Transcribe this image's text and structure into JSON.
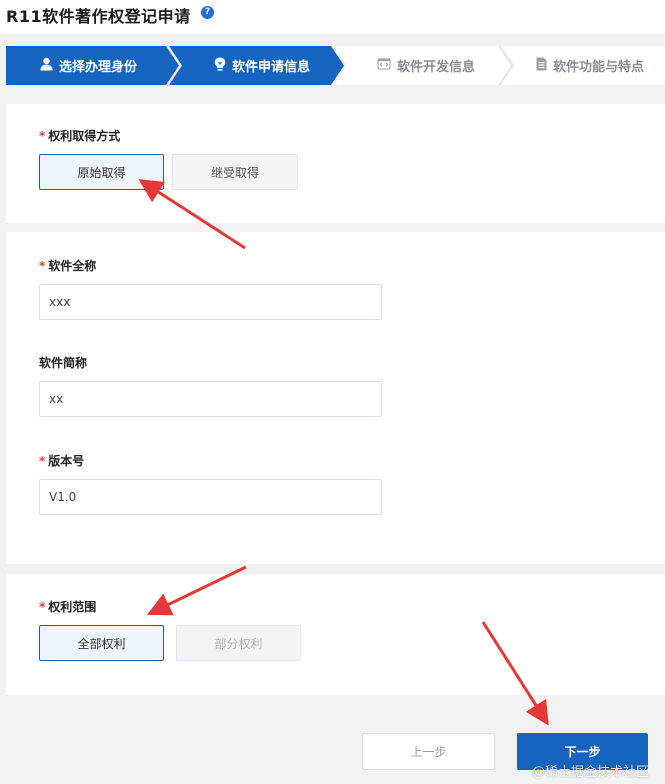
{
  "header": {
    "title": "R11软件著作权登记申请",
    "help_icon": "question-circle-icon"
  },
  "steps": [
    {
      "label": "选择办理身份",
      "icon": "user-icon",
      "state": "completed"
    },
    {
      "label": "软件申请信息",
      "icon": "lightbulb-icon",
      "state": "active"
    },
    {
      "label": "软件开发信息",
      "icon": "code-window-icon",
      "state": "inactive"
    },
    {
      "label": "软件功能与特点",
      "icon": "document-icon",
      "state": "inactive"
    }
  ],
  "acquisition": {
    "label": "权利取得方式",
    "options": [
      "原始取得",
      "继受取得"
    ],
    "selected": "原始取得"
  },
  "software": {
    "full_name_label": "软件全称",
    "full_name_value": "xxx",
    "short_name_label": "软件简称",
    "short_name_value": "xx",
    "version_label": "版本号",
    "version_value": "V1.0"
  },
  "rights_scope": {
    "label": "权利范围",
    "options": [
      "全部权利",
      "部分权利"
    ],
    "selected": "全部权利"
  },
  "footer": {
    "prev_label": "上一步",
    "next_label": "下一步"
  },
  "watermark": "@稀土掘金技术社区",
  "colors": {
    "primary": "#1565c0",
    "required": "#e23b3b",
    "annotation_arrow": "#e53935"
  }
}
